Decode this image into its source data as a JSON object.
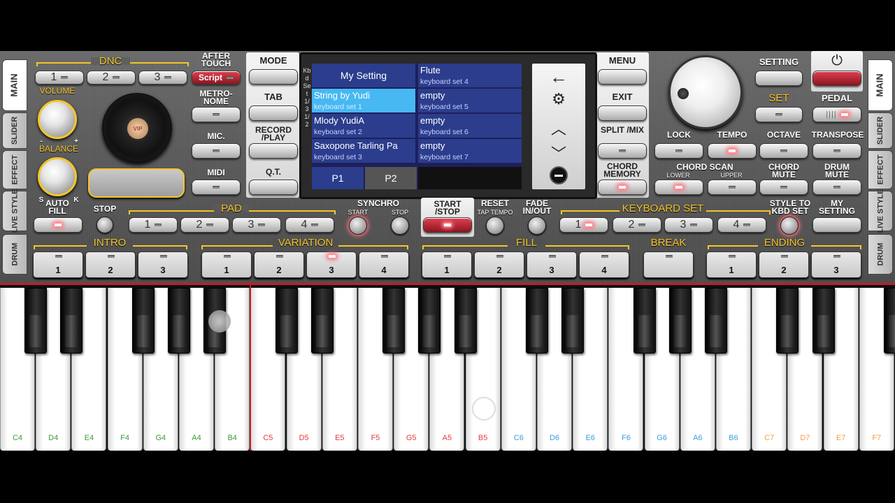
{
  "left_tabs": [
    "MAIN",
    "SLIDER",
    "EFFECT",
    "LIVE STYLE",
    "DRUM"
  ],
  "right_tabs": [
    "MAIN",
    "SLIDER",
    "EFFECT",
    "LIVE STYLE",
    "DRUM"
  ],
  "dnc": {
    "label": "DNC",
    "buttons": [
      "1",
      "2",
      "3"
    ],
    "script": "Script"
  },
  "after_touch": "AFTER TOUCH",
  "volume": "VOLUME",
  "volume_min": "-",
  "volume_max": "+",
  "balance": "BALANCE",
  "balance_s": "S",
  "balance_k": "K",
  "vip": "VIP",
  "metronome": "METRO-NOME",
  "mic": "MIC.",
  "midi": "MIDI",
  "mode": "MODE",
  "tab": "TAB",
  "record_play": "RECORD /PLAY",
  "qt": "Q.T.",
  "screen": {
    "side_label": "Kbd Set 1/3 1/2",
    "slots_left": [
      {
        "name": "My Setting",
        "set": ""
      },
      {
        "name": "String by Yudi",
        "set": "keyboard set 1"
      },
      {
        "name": "Mlody YudiA",
        "set": "keyboard set 2"
      },
      {
        "name": "Saxopone Tarling Pa",
        "set": "keyboard set 3"
      }
    ],
    "slots_right": [
      {
        "name": "Flute",
        "set": "keyboard set 4"
      },
      {
        "name": "empty",
        "set": "keyboard set 5"
      },
      {
        "name": "empty",
        "set": "keyboard set 6"
      },
      {
        "name": "empty",
        "set": "keyboard set 7"
      }
    ],
    "pages": [
      "P1",
      "P2"
    ],
    "icons": [
      "back-arrow-icon",
      "gear-icon",
      "chevron-up-icon",
      "chevron-down-icon",
      "minus-icon"
    ]
  },
  "menu": "MENU",
  "exit": "EXIT",
  "split_mix": "SPLIT /MIX",
  "chord_memory": "CHORD MEMORY",
  "setting": "SETTING",
  "set": "SET",
  "pedal": "PEDAL",
  "lock": "LOCK",
  "tempo": "TEMPO",
  "octave": "OCTAVE",
  "transpose": "TRANSPOSE",
  "chord_scan": "CHORD SCAN",
  "lower": "LOWER",
  "upper": "UPPER",
  "chord_mute": "CHORD MUTE",
  "drum_mute": "DRUM MUTE",
  "auto_fill": "AUTO FILL",
  "stop": "STOP",
  "pad": {
    "label": "PAD",
    "buttons": [
      "1",
      "2",
      "3",
      "4"
    ]
  },
  "synchro": "SYNCHRO",
  "synchro_start": "START",
  "synchro_stop": "STOP",
  "start_stop": "START /STOP",
  "reset": "RESET",
  "tap_tempo": "TAP TEMPO",
  "fade": "FADE IN/OUT",
  "keyboard_set": {
    "label": "KEYBOARD SET",
    "buttons": [
      "1",
      "2",
      "3",
      "4"
    ]
  },
  "style_to_kbd": "STYLE TO KBD SET",
  "my_setting": "MY SETTING",
  "intro": {
    "label": "INTRO",
    "buttons": [
      "1",
      "2",
      "3"
    ]
  },
  "variation": {
    "label": "VARIATION",
    "buttons": [
      "1",
      "2",
      "3",
      "4"
    ]
  },
  "fill": {
    "label": "FILL",
    "buttons": [
      "1",
      "2",
      "3",
      "4"
    ]
  },
  "break": "BREAK",
  "ending": {
    "label": "ENDING",
    "buttons": [
      "1",
      "2",
      "3"
    ]
  },
  "white_keys": [
    {
      "n": "C4",
      "c": "#3c9a3c"
    },
    {
      "n": "D4",
      "c": "#3c9a3c"
    },
    {
      "n": "E4",
      "c": "#3c9a3c"
    },
    {
      "n": "F4",
      "c": "#3c9a3c"
    },
    {
      "n": "G4",
      "c": "#3c9a3c"
    },
    {
      "n": "A4",
      "c": "#3c9a3c"
    },
    {
      "n": "B4",
      "c": "#3c9a3c"
    },
    {
      "n": "C5",
      "c": "#e04040"
    },
    {
      "n": "D5",
      "c": "#e04040"
    },
    {
      "n": "E5",
      "c": "#e04040"
    },
    {
      "n": "F5",
      "c": "#e04040"
    },
    {
      "n": "G5",
      "c": "#e04040"
    },
    {
      "n": "A5",
      "c": "#e04040"
    },
    {
      "n": "B5",
      "c": "#e04040"
    },
    {
      "n": "C6",
      "c": "#3aa0d8"
    },
    {
      "n": "D6",
      "c": "#3aa0d8"
    },
    {
      "n": "E6",
      "c": "#3aa0d8"
    },
    {
      "n": "F6",
      "c": "#3aa0d8"
    },
    {
      "n": "G6",
      "c": "#3aa0d8"
    },
    {
      "n": "A6",
      "c": "#3aa0d8"
    },
    {
      "n": "B6",
      "c": "#3aa0d8"
    },
    {
      "n": "C7",
      "c": "#f0a040"
    },
    {
      "n": "D7",
      "c": "#f0a040"
    },
    {
      "n": "E7",
      "c": "#f0a040"
    },
    {
      "n": "F7",
      "c": "#f0a040"
    }
  ]
}
